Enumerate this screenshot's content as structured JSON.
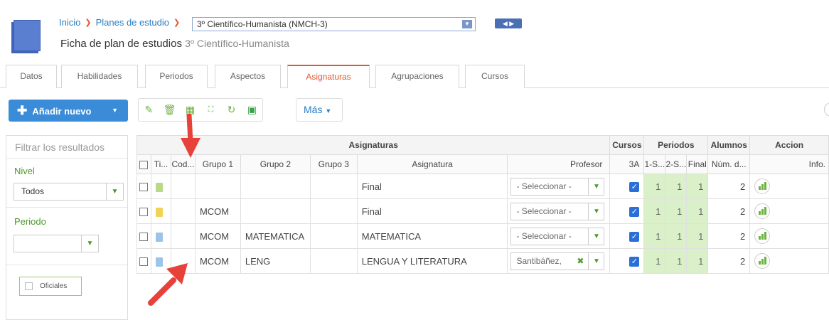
{
  "breadcrumb": {
    "home": "Inicio",
    "plans": "Planes de estudio",
    "current": "3º Científico-Humanista (NMCH-3)"
  },
  "title": {
    "main": "Ficha de plan de estudios",
    "sub": "3º Científico-Humanista"
  },
  "tabs": [
    "Datos",
    "Habilidades",
    "Periodos",
    "Aspectos",
    "Asignaturas",
    "Agrupaciones",
    "Cursos"
  ],
  "active_tab": "Asignaturas",
  "toolbar": {
    "add_label": "Añadir nuevo",
    "more_label": "Más"
  },
  "sidebar": {
    "filter_placeholder": "Filtrar los resultados",
    "nivel_label": "Nivel",
    "nivel_value": "Todos",
    "periodo_label": "Periodo",
    "periodo_value": "",
    "oficiales_label": "Oficiales"
  },
  "grid": {
    "group_headers": {
      "asignaturas": "Asignaturas",
      "cursos": "Cursos",
      "periodos": "Periodos",
      "alumnos": "Alumnos",
      "acciones": "Accion"
    },
    "columns": {
      "ti": "Ti...",
      "cod": "Cod...",
      "g1": "Grupo 1",
      "g2": "Grupo 2",
      "g3": "Grupo 3",
      "asig": "Asignatura",
      "prof": "Profesor",
      "curso": "3A",
      "p1": "1-S...",
      "p2": "2-S...",
      "fin": "Final",
      "num": "Núm. d...",
      "info": "Info."
    },
    "rows": [
      {
        "g1": "",
        "g2": "",
        "g3": "",
        "asig": "Final",
        "prof": "- Seleccionar -",
        "prof_clear": false,
        "p1": "1",
        "p2": "1",
        "fin": "1",
        "num": "2",
        "doc_color": "#b8d98a"
      },
      {
        "g1": "MCOM",
        "g2": "",
        "g3": "",
        "asig": "Final",
        "prof": "- Seleccionar -",
        "prof_clear": false,
        "p1": "1",
        "p2": "1",
        "fin": "1",
        "num": "2",
        "doc_color": "#f2d35a"
      },
      {
        "g1": "MCOM",
        "g2": "MATEMATICA",
        "g3": "",
        "asig": "MATEMATICA",
        "prof": "- Seleccionar -",
        "prof_clear": false,
        "p1": "1",
        "p2": "1",
        "fin": "1",
        "num": "2",
        "doc_color": "#9cc4ea"
      },
      {
        "g1": "MCOM",
        "g2": "LENG",
        "g3": "",
        "asig": "LENGUA Y LITERATURA",
        "prof": "Santibáñez,",
        "prof_clear": true,
        "p1": "1",
        "p2": "1",
        "fin": "1",
        "num": "2",
        "doc_color": "#9cc4ea"
      }
    ]
  },
  "colors": {
    "accent": "#e2572b",
    "primary": "#3a8cd8",
    "green": "#4c9a2a",
    "period_fill": "#d9f0c9"
  }
}
